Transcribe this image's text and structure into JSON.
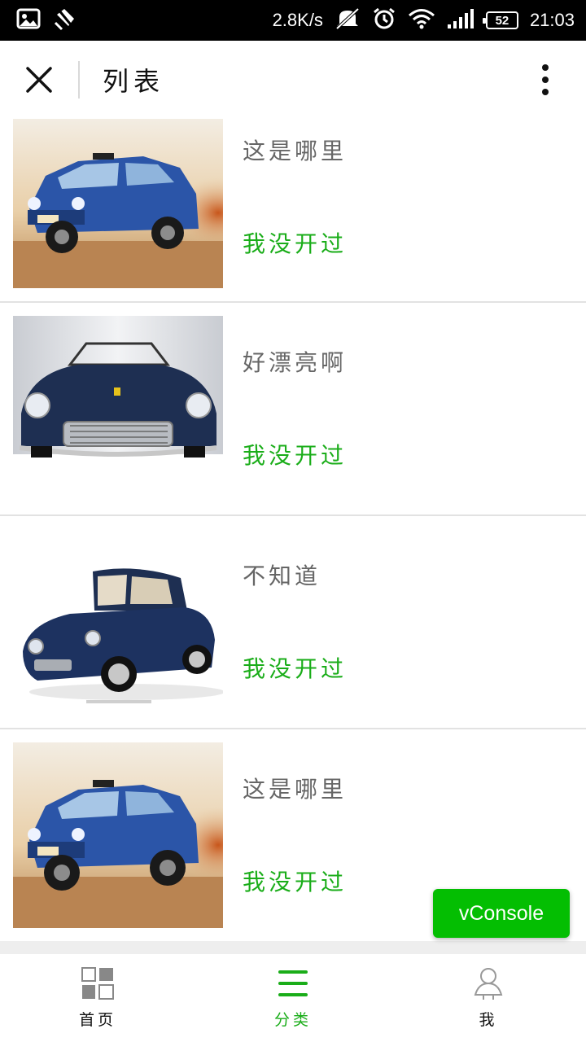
{
  "status_bar": {
    "network_speed": "2.8K/s",
    "battery": "52",
    "time": "21:03",
    "icons": [
      "image-icon",
      "notification-off-icon",
      "silent-icon",
      "alarm-icon",
      "wifi-icon",
      "signal-icon",
      "battery-icon"
    ]
  },
  "nav": {
    "title": "列表",
    "close_icon": "close-icon",
    "more_icon": "more-vertical-icon"
  },
  "list": {
    "items": [
      {
        "title": "这是哪里",
        "subtitle": "我没开过",
        "image": "blue-rally-car"
      },
      {
        "title": "好漂亮啊",
        "subtitle": "我没开过",
        "image": "navy-convertible-front"
      },
      {
        "title": "不知道",
        "subtitle": "我没开过",
        "image": "navy-convertible-side"
      },
      {
        "title": "这是哪里",
        "subtitle": "我没开过",
        "image": "blue-rally-car"
      }
    ]
  },
  "vconsole": {
    "label": "vConsole"
  },
  "tabs": [
    {
      "label": "首页",
      "icon": "grid-icon",
      "active": false
    },
    {
      "label": "分类",
      "icon": "menu-icon",
      "active": true
    },
    {
      "label": "我",
      "icon": "user-icon",
      "active": false
    }
  ],
  "colors": {
    "accent": "#1aad19",
    "vconsole": "#04be02",
    "title_text": "#666666"
  }
}
